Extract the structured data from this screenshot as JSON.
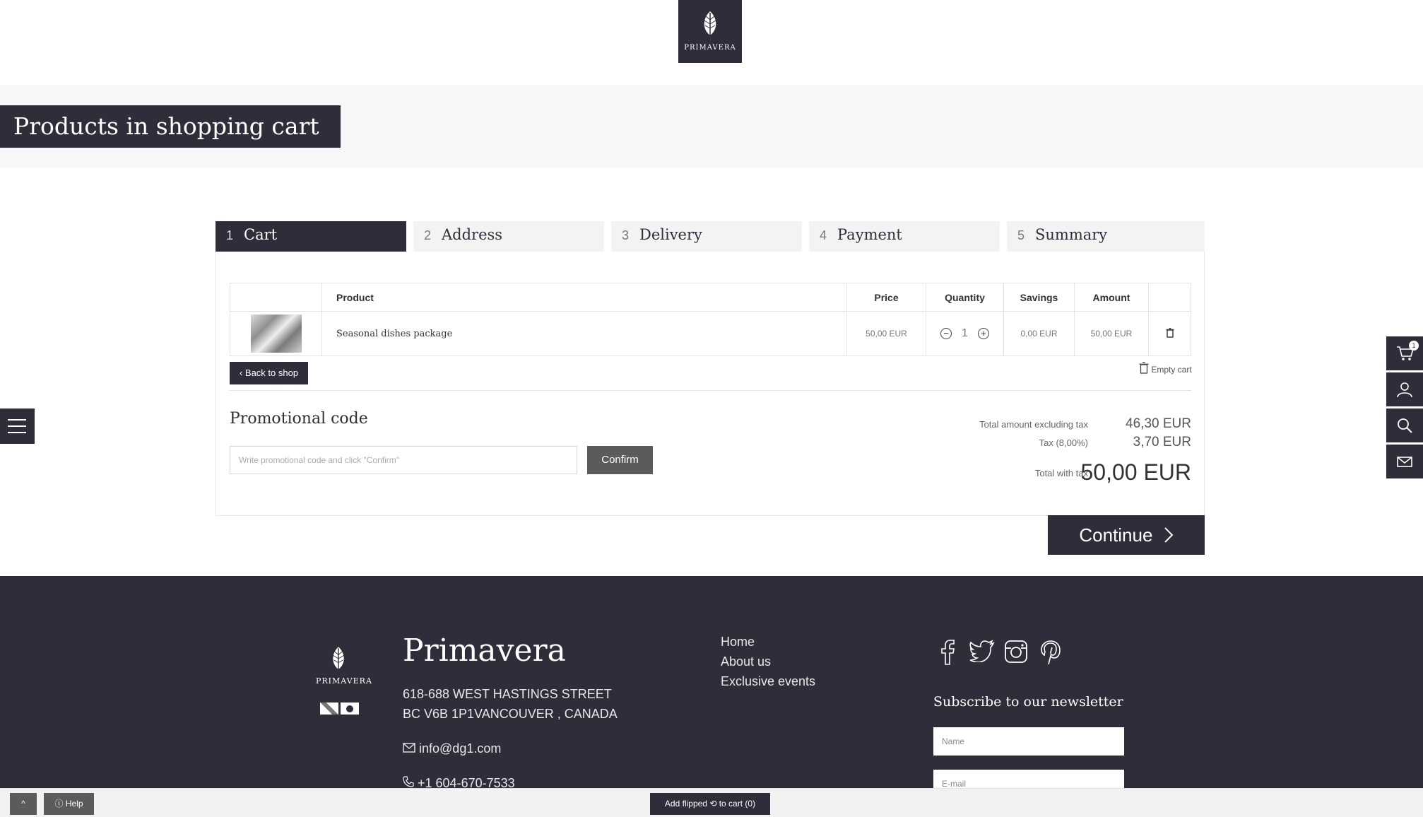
{
  "header": {
    "logo_text": "PRIMAVERA"
  },
  "banner": {
    "title": "Products in shopping cart"
  },
  "steps": [
    {
      "num": "1",
      "label": "Cart"
    },
    {
      "num": "2",
      "label": "Address"
    },
    {
      "num": "3",
      "label": "Delivery"
    },
    {
      "num": "4",
      "label": "Payment"
    },
    {
      "num": "5",
      "label": "Summary"
    }
  ],
  "cart": {
    "columns": {
      "product": "Product",
      "price": "Price",
      "quantity": "Quantity",
      "savings": "Savings",
      "amount": "Amount"
    },
    "rows": [
      {
        "product": "Seasonal dishes package",
        "price": "50,00 EUR",
        "quantity": "1",
        "savings": "0,00 EUR",
        "amount": "50,00 EUR"
      }
    ],
    "back_label": "Back to shop",
    "empty_label": "Empty cart"
  },
  "promo": {
    "title": "Promotional code",
    "placeholder": "Write promotional code and click \"Confirm\"",
    "confirm_label": "Confirm"
  },
  "totals": {
    "excl_label": "Total amount excluding tax",
    "excl_value": "46,30 EUR",
    "tax_label": "Tax (8,00%)",
    "tax_value": "3,70 EUR",
    "total_label": "Total with tax",
    "total_value": "50,00 EUR"
  },
  "continue_label": "Continue",
  "side": {
    "cart_count": "1"
  },
  "footer": {
    "logo_text": "PRIMAVERA",
    "brand": "Primavera",
    "address1": "618-688 WEST HASTINGS STREET",
    "address2": "BC V6B 1P1VANCOUVER , CANADA",
    "email": "info@dg1.com",
    "phone": "+1 604-670-7533",
    "links": [
      "Home",
      "About us",
      "Exclusive events"
    ],
    "newsletter_title": "Subscribe to our newsletter",
    "name_placeholder": "Name",
    "email_placeholder": "E-mail"
  },
  "bottom": {
    "up_label": "^",
    "help_label": "Help",
    "flip_label": "Add flipped",
    "flip_suffix": "to cart (0)"
  },
  "colors": {
    "brand": "#2e2d3a",
    "banner_bg": "#f7f7f7",
    "button_gray": "#5b5b5b"
  }
}
